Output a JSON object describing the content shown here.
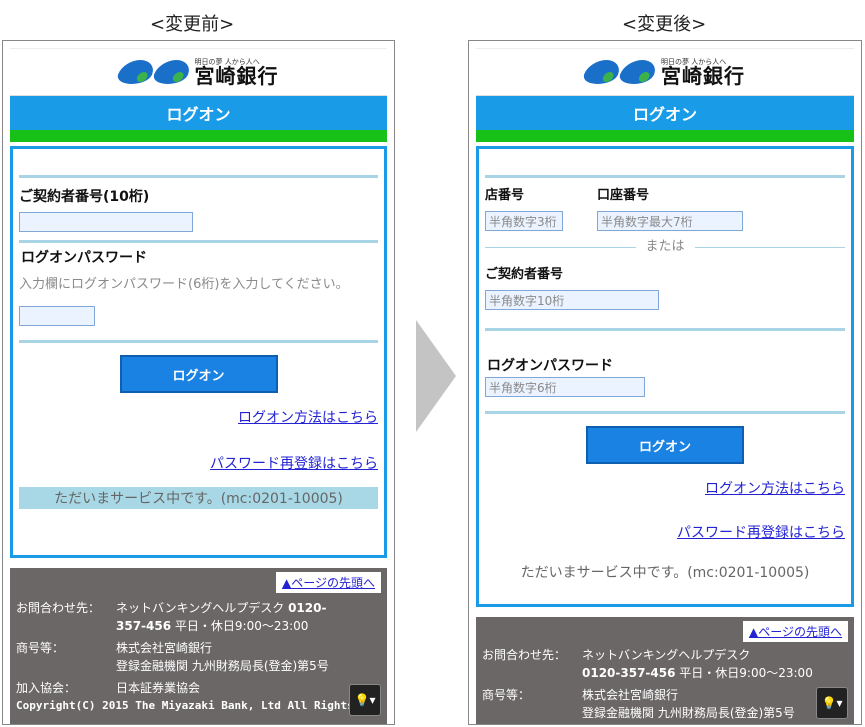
{
  "captions": {
    "before": "<変更前>",
    "after": "<変更後>"
  },
  "brand": {
    "slogan": "明日の夢 人から人へ",
    "name": "宮崎銀行"
  },
  "before": {
    "title": "ログオン",
    "contract_label": "ご契約者番号(10桁)",
    "password_label": "ログオンパスワード",
    "password_hint": "入力欄にログオンパスワード(6桁)を入力してください。",
    "logon_button": "ログオン",
    "logon_method_link": "ログオン方法はこちら",
    "password_reset_link": "パスワード再登録はこちら",
    "status": "ただいまサービス中です。(mc:0201-10005)",
    "footer": {
      "pagetop": "▲ページの先頭へ",
      "inquiry_key": "お問合わせ先：",
      "inquiry_val1": "ネットバンキングヘルプデスク",
      "inquiry_phone_a": "0120-",
      "inquiry_phone_b": "357-456",
      "inquiry_hours": "平日・休日9:00～23:00",
      "trade_key": "商号等：",
      "trade_val1": "株式会社宮崎銀行",
      "trade_val2": "登録金融機関 九州財務局長(登金)第5号",
      "assoc_key": "加入協会：",
      "assoc_val": "日本証券業協会",
      "copyright": "Copyright(C) 2015 The Miyazaki Bank, Ltd All Rights"
    }
  },
  "after": {
    "title": "ログオン",
    "branch_label": "店番号",
    "branch_placeholder": "半角数字3桁",
    "account_label": "口座番号",
    "account_placeholder": "半角数字最大7桁",
    "or_text": "または",
    "contract_label": "ご契約者番号",
    "contract_placeholder": "半角数字10桁",
    "password_label": "ログオンパスワード",
    "password_placeholder": "半角数字6桁",
    "logon_button": "ログオン",
    "logon_method_link": "ログオン方法はこちら",
    "password_reset_link": "パスワード再登録はこちら",
    "status": "ただいまサービス中です。(mc:0201-10005)",
    "footer": {
      "pagetop": "▲ページの先頭へ",
      "inquiry_key": "お問合わせ先：",
      "inquiry_val1": "ネットバンキングヘルプデスク",
      "inquiry_phone": "0120-357-456",
      "inquiry_hours": "平日・休日9:00～23:00",
      "trade_key": "商号等：",
      "trade_val1": "株式会社宮崎銀行",
      "trade_val2": "登録金融機関 九州財務局長(登金)第5号"
    }
  },
  "icons": {
    "fab": "lightbulb-icon",
    "arrow": "right-arrow-icon"
  },
  "colors": {
    "title_bar": "#1a9be8",
    "green_bar": "#17c117",
    "button": "#1a82e2",
    "link": "#2323d4",
    "footer": "#6b6767"
  }
}
